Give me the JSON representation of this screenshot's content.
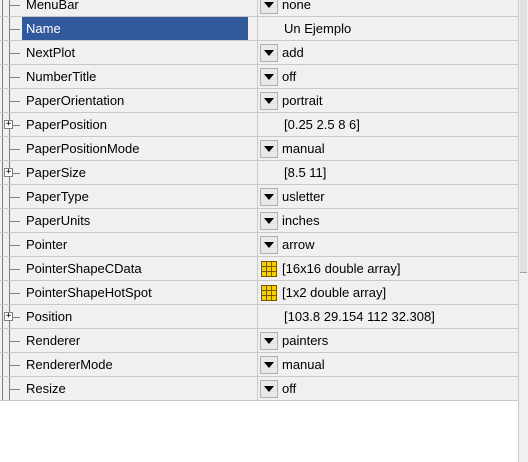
{
  "properties": [
    {
      "name": "MenuBar",
      "value": "none",
      "control": "dropdown",
      "expandable": false,
      "selected": false
    },
    {
      "name": "Name",
      "value": "Un Ejemplo",
      "control": "text",
      "expandable": false,
      "selected": true
    },
    {
      "name": "NextPlot",
      "value": "add",
      "control": "dropdown",
      "expandable": false,
      "selected": false
    },
    {
      "name": "NumberTitle",
      "value": "off",
      "control": "dropdown",
      "expandable": false,
      "selected": false
    },
    {
      "name": "PaperOrientation",
      "value": "portrait",
      "control": "dropdown",
      "expandable": false,
      "selected": false
    },
    {
      "name": "PaperPosition",
      "value": "[0.25 2.5 8 6]",
      "control": "text",
      "expandable": true,
      "selected": false
    },
    {
      "name": "PaperPositionMode",
      "value": "manual",
      "control": "dropdown",
      "expandable": false,
      "selected": false
    },
    {
      "name": "PaperSize",
      "value": "[8.5 11]",
      "control": "text",
      "expandable": true,
      "selected": false
    },
    {
      "name": "PaperType",
      "value": "usletter",
      "control": "dropdown",
      "expandable": false,
      "selected": false
    },
    {
      "name": "PaperUnits",
      "value": "inches",
      "control": "dropdown",
      "expandable": false,
      "selected": false
    },
    {
      "name": "Pointer",
      "value": "arrow",
      "control": "dropdown",
      "expandable": false,
      "selected": false
    },
    {
      "name": "PointerShapeCData",
      "value": "[16x16  double array]",
      "control": "array",
      "expandable": false,
      "selected": false
    },
    {
      "name": "PointerShapeHotSpot",
      "value": "[1x2  double array]",
      "control": "array",
      "expandable": false,
      "selected": false
    },
    {
      "name": "Position",
      "value": "[103.8 29.154 112 32.308]",
      "control": "text",
      "expandable": true,
      "selected": false
    },
    {
      "name": "Renderer",
      "value": "painters",
      "control": "dropdown",
      "expandable": false,
      "selected": false
    },
    {
      "name": "RendererMode",
      "value": "manual",
      "control": "dropdown",
      "expandable": false,
      "selected": false
    },
    {
      "name": "Resize",
      "value": "off",
      "control": "dropdown",
      "expandable": false,
      "selected": false
    }
  ],
  "icons": {
    "dropdown": "dropdown-arrow-icon",
    "array": "array-editor-icon",
    "expander": "plus-expand-icon"
  },
  "colors": {
    "selection": "#31599c",
    "array_icon": "#f5d000"
  }
}
